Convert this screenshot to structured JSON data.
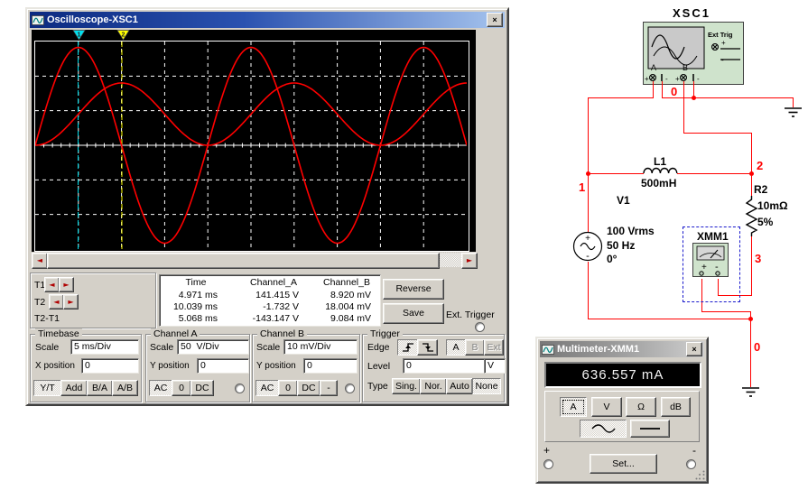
{
  "scope_window": {
    "title": "Oscilloscope-XSC1",
    "close_glyph": "×",
    "scrollbar": {
      "left": "◄",
      "right": "►"
    },
    "readout": {
      "t1_label": "T1",
      "t2_label": "T2",
      "dt_label": "T2-T1",
      "left_arrow": "◄",
      "right_arrow": "►",
      "headers": {
        "time": "Time",
        "a": "Channel_A",
        "b": "Channel_B"
      },
      "rows": [
        {
          "time": "4.971 ms",
          "a": "141.415 V",
          "b": "8.920 mV"
        },
        {
          "time": "10.039 ms",
          "a": "-1.732 V",
          "b": "18.004 mV"
        },
        {
          "time": "5.068 ms",
          "a": "-143.147 V",
          "b": "9.084 mV"
        }
      ],
      "reverse": "Reverse",
      "save": "Save",
      "ext_trigger": "Ext. Trigger"
    },
    "timebase": {
      "caption": "Timebase",
      "scale_label": "Scale",
      "scale": "5 ms/Div",
      "pos_label": "X position",
      "pos": "0",
      "buttons": [
        "Y/T",
        "Add",
        "B/A",
        "A/B"
      ]
    },
    "channel_a": {
      "caption": "Channel A",
      "scale_label": "Scale",
      "scale": "50  V/Div",
      "pos_label": "Y position",
      "pos": "0",
      "buttons": [
        "AC",
        "0",
        "DC"
      ]
    },
    "channel_b": {
      "caption": "Channel B",
      "scale_label": "Scale",
      "scale": "10 mV/Div",
      "pos_label": "Y position",
      "pos": "0",
      "buttons": [
        "AC",
        "0",
        "DC",
        "-"
      ]
    },
    "trigger": {
      "caption": "Trigger",
      "edge_label": "Edge",
      "source_buttons": [
        "A",
        "B",
        "Ext"
      ],
      "level_label": "Level",
      "level": "0",
      "level_unit": "V",
      "type_label": "Type",
      "type_buttons": [
        "Sing.",
        "Nor.",
        "Auto",
        "None"
      ]
    }
  },
  "multimeter_window": {
    "title": "Multimeter-XMM1",
    "close_glyph": "×",
    "display": "636.557 mA",
    "mode_buttons": [
      "A",
      "V",
      "Ω",
      "dB"
    ],
    "set_button": "Set...",
    "plus": "+",
    "minus": "-"
  },
  "circuit": {
    "xsc1": "XSC1",
    "ext_trig": "Ext Trig",
    "ch_a": "A",
    "ch_b": "B",
    "plus": "+",
    "minus": "-",
    "node0_top": "0",
    "node1": "1",
    "node2": "2",
    "node3": "3",
    "node0_bottom": "0",
    "l1": "L1",
    "l1_value": "500mH",
    "r2": "R2",
    "r2_value": "10mΩ",
    "r2_tolerance": "5%",
    "v1": "V1",
    "v1_line1": "100 Vrms",
    "v1_line2": "50 Hz",
    "v1_line3": "0°",
    "xmm1": "XMM1"
  },
  "chart_data": {
    "type": "line",
    "title": "Oscilloscope trace: Channel A source voltage, Channel B resistor voltage",
    "background": "#000000",
    "grid": {
      "color": "#ffffff",
      "style": "dashed",
      "x_divisions": 10,
      "y_divisions": 6
    },
    "x_axis": {
      "label": "Time",
      "ms_per_div": 5,
      "range_ms": [
        0,
        50
      ]
    },
    "series": [
      {
        "name": "Channel A",
        "color": "#ff0000",
        "waveform": "sine",
        "frequency_hz": 50,
        "peak_value": "141.42 V",
        "volts_per_div": 50,
        "amplitude_div": 2.83,
        "offset_div": 0
      },
      {
        "name": "Channel B",
        "color": "#ff0000",
        "waveform": "raised-cosine",
        "frequency_hz": 50,
        "peak_value": "18 mV",
        "mv_per_div": 10,
        "amplitude_div": 0.9,
        "offset_div": 0
      }
    ],
    "markers": [
      {
        "name": "T1",
        "label": "1",
        "time_ms": 4.971,
        "color": "#00e0ee"
      },
      {
        "name": "T2",
        "label": "2",
        "time_ms": 10.039,
        "color": "#ffff00"
      }
    ]
  }
}
